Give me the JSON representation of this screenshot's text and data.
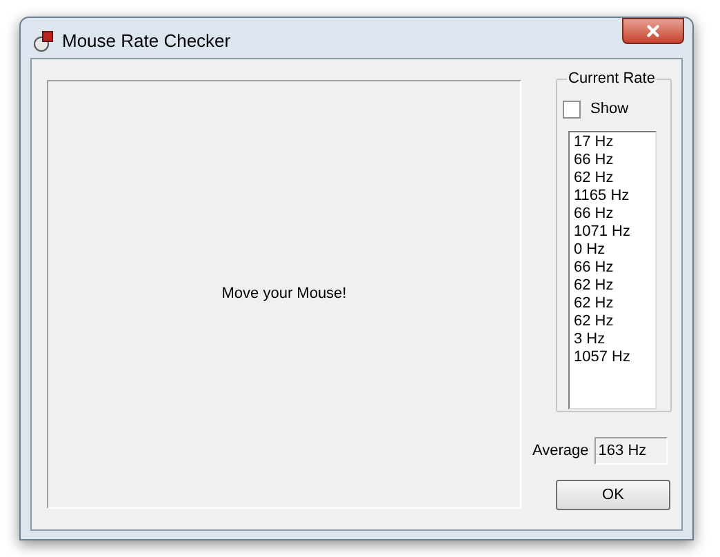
{
  "window": {
    "title": "Mouse Rate Checker"
  },
  "canvas": {
    "message": "Move your Mouse!"
  },
  "current_rate": {
    "title": "Current Rate",
    "show": {
      "label": "Show",
      "checked": false
    },
    "rates": [
      "17 Hz",
      "66 Hz",
      "62 Hz",
      "1165 Hz",
      "66 Hz",
      "1071 Hz",
      "0 Hz",
      "66 Hz",
      "62 Hz",
      "62 Hz",
      "62 Hz",
      "3 Hz",
      "1057 Hz"
    ]
  },
  "average": {
    "label": "Average",
    "value": "163 Hz"
  },
  "buttons": [
    "OK"
  ]
}
